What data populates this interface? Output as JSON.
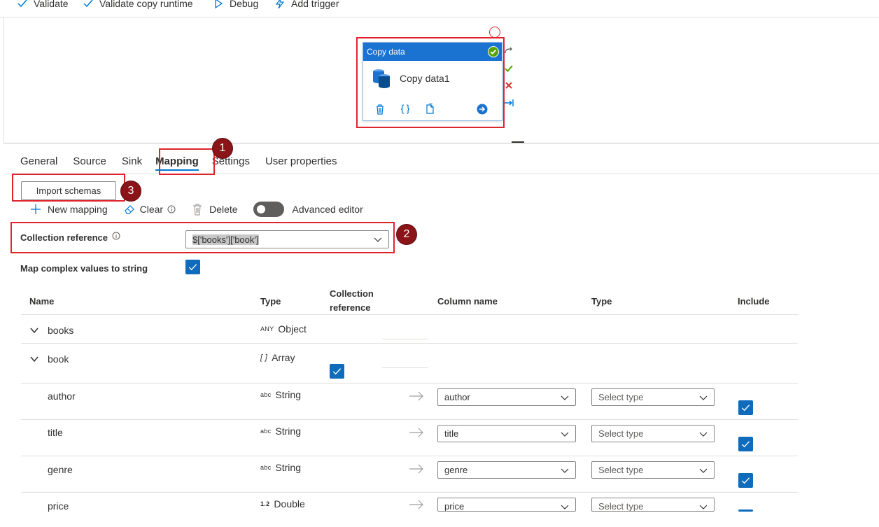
{
  "toolbar": {
    "validate": "Validate",
    "validate_copy_runtime": "Validate copy runtime",
    "debug": "Debug",
    "add_trigger": "Add trigger"
  },
  "activity": {
    "header": "Copy data",
    "name": "Copy data1"
  },
  "badges": {
    "one": "1",
    "two": "2",
    "three": "3"
  },
  "tabs": [
    "General",
    "Source",
    "Sink",
    "Mapping",
    "Settings",
    "User properties"
  ],
  "active_tab": "Mapping",
  "import_schemas": "Import schemas",
  "actions": {
    "new_mapping": "New mapping",
    "clear": "Clear",
    "delete": "Delete",
    "advanced_editor": "Advanced editor"
  },
  "collection_reference": {
    "label": "Collection reference",
    "value": "$['books']['book']"
  },
  "map_complex": {
    "label": "Map complex values to string",
    "checked": true
  },
  "table": {
    "headers": {
      "name": "Name",
      "type": "Type",
      "collection_reference_1": "Collection",
      "collection_reference_2": "reference",
      "column_name": "Column name",
      "dest_type": "Type",
      "include": "Include"
    },
    "rows": [
      {
        "name": "books",
        "type_icon": "ANY",
        "type": "Object"
      },
      {
        "name": "book",
        "type_icon": "[ ]",
        "type": "Array",
        "collection_ref": true
      },
      {
        "name": "author",
        "type_icon": "abc",
        "type": "String",
        "column": "author",
        "dest_type": "Select type",
        "include": true
      },
      {
        "name": "title",
        "type_icon": "abc",
        "type": "String",
        "column": "title",
        "dest_type": "Select type",
        "include": true
      },
      {
        "name": "genre",
        "type_icon": "abc",
        "type": "String",
        "column": "genre",
        "dest_type": "Select type",
        "include": true
      },
      {
        "name": "price",
        "type_icon": "1.2",
        "type": "Double",
        "column": "price",
        "dest_type": "Select type",
        "include": true
      }
    ]
  },
  "colors": {
    "accent": "#0078d4",
    "annotation_red": "#e0242c",
    "badge": "#8b1418",
    "node_header": "#1a73d0",
    "success": "#57a300"
  }
}
